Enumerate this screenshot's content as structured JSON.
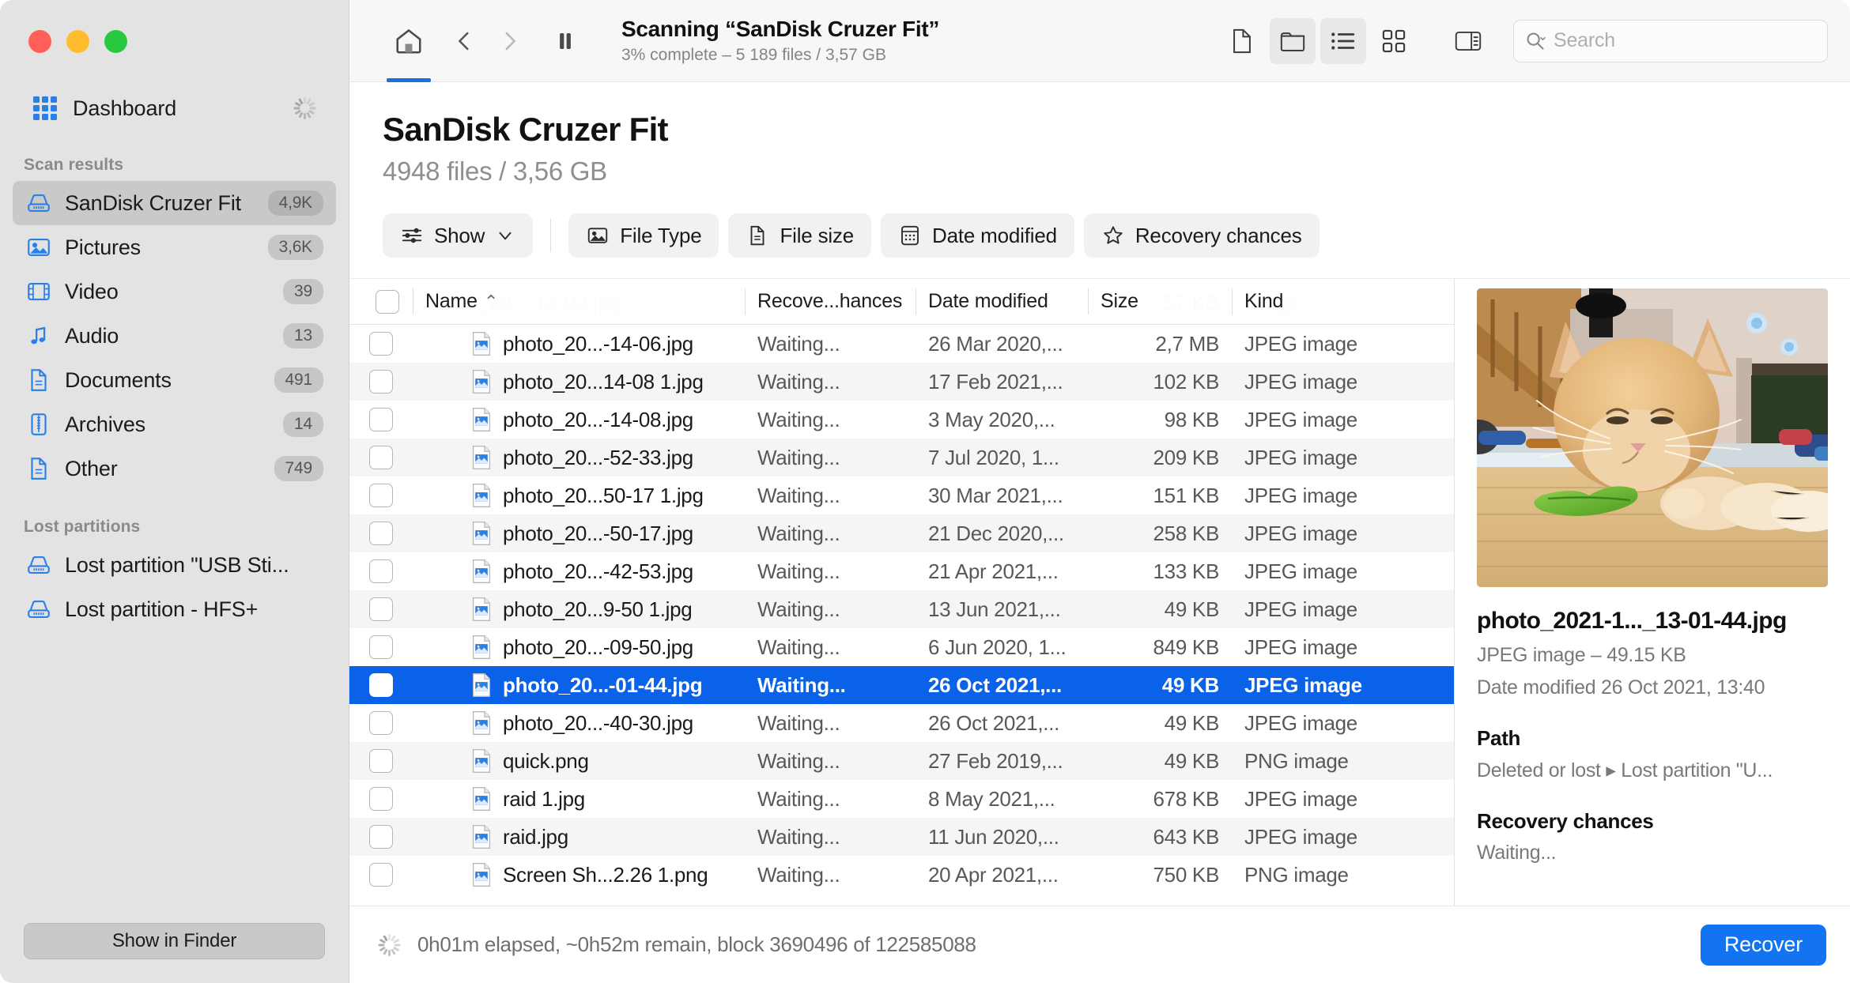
{
  "window": {
    "traffic_lights": [
      "close",
      "minimize",
      "maximize"
    ]
  },
  "sidebar": {
    "dashboard_label": "Dashboard",
    "scan_results_header": "Scan results",
    "scan_results": [
      {
        "label": "SanDisk Cruzer Fit",
        "badge": "4,9K",
        "icon": "drive-icon",
        "selected": true
      },
      {
        "label": "Pictures",
        "badge": "3,6K",
        "icon": "picture-icon",
        "selected": false
      },
      {
        "label": "Video",
        "badge": "39",
        "icon": "video-icon",
        "selected": false
      },
      {
        "label": "Audio",
        "badge": "13",
        "icon": "audio-icon",
        "selected": false
      },
      {
        "label": "Documents",
        "badge": "491",
        "icon": "document-icon",
        "selected": false
      },
      {
        "label": "Archives",
        "badge": "14",
        "icon": "archive-icon",
        "selected": false
      },
      {
        "label": "Other",
        "badge": "749",
        "icon": "document-icon",
        "selected": false
      }
    ],
    "lost_partitions_header": "Lost partitions",
    "lost_partitions": [
      {
        "label": "Lost partition \"USB Sti...",
        "icon": "drive-icon"
      },
      {
        "label": "Lost partition - HFS+",
        "icon": "drive-icon"
      }
    ],
    "show_in_finder_label": "Show in Finder"
  },
  "toolbar": {
    "home_icon": "home-icon",
    "back_icon": "chevron-left-icon",
    "forward_icon": "chevron-right-icon",
    "pause_icon": "pause-icon",
    "title": "Scanning “SanDisk Cruzer Fit”",
    "subtitle": "3% complete – 5 189 files / 3,57 GB",
    "view_buttons": [
      {
        "icon": "file-view-icon",
        "active": false
      },
      {
        "icon": "folder-view-icon",
        "active": true
      },
      {
        "icon": "list-view-icon",
        "active": true
      },
      {
        "icon": "grid-view-icon",
        "active": false
      },
      {
        "icon": "sidebar-toggle-icon",
        "active": false
      }
    ],
    "search_placeholder": "Search",
    "search_value": "",
    "search_icon": "search-icon"
  },
  "page": {
    "title": "SanDisk Cruzer Fit",
    "subtitle": "4948 files / 3,56 GB"
  },
  "filters": [
    {
      "label": "Show",
      "icon": "sliders-icon",
      "caret": true
    },
    {
      "label": "File Type",
      "icon": "picture-icon",
      "caret": false
    },
    {
      "label": "File size",
      "icon": "document-icon",
      "caret": false
    },
    {
      "label": "Date modified",
      "icon": "calendar-icon",
      "caret": false
    },
    {
      "label": "Recovery chances",
      "icon": "star-icon",
      "caret": false
    }
  ],
  "table": {
    "ghost_row": {
      "name": "photo_20...-14-02.jpg",
      "size": "57 KB",
      "kind": "image"
    },
    "columns": [
      {
        "key": "check",
        "label": ""
      },
      {
        "key": "name",
        "label": "Name",
        "sorted": true,
        "sort_caret": "⌃"
      },
      {
        "key": "recovery",
        "label": "Recove...hances"
      },
      {
        "key": "date",
        "label": "Date modified"
      },
      {
        "key": "size",
        "label": "Size"
      },
      {
        "key": "kind",
        "label": "Kind"
      }
    ],
    "rows": [
      {
        "name": "photo_20...-14-06.jpg",
        "recovery": "Waiting...",
        "date": "26 Mar 2020,...",
        "size": "2,7 MB",
        "kind": "JPEG image",
        "selected": false
      },
      {
        "name": "photo_20...14-08 1.jpg",
        "recovery": "Waiting...",
        "date": "17 Feb 2021,...",
        "size": "102 KB",
        "kind": "JPEG image",
        "selected": false
      },
      {
        "name": "photo_20...-14-08.jpg",
        "recovery": "Waiting...",
        "date": "3 May 2020,...",
        "size": "98 KB",
        "kind": "JPEG image",
        "selected": false
      },
      {
        "name": "photo_20...-52-33.jpg",
        "recovery": "Waiting...",
        "date": "7 Jul 2020, 1...",
        "size": "209 KB",
        "kind": "JPEG image",
        "selected": false
      },
      {
        "name": "photo_20...50-17 1.jpg",
        "recovery": "Waiting...",
        "date": "30 Mar 2021,...",
        "size": "151 KB",
        "kind": "JPEG image",
        "selected": false
      },
      {
        "name": "photo_20...-50-17.jpg",
        "recovery": "Waiting...",
        "date": "21 Dec 2020,...",
        "size": "258 KB",
        "kind": "JPEG image",
        "selected": false
      },
      {
        "name": "photo_20...-42-53.jpg",
        "recovery": "Waiting...",
        "date": "21 Apr 2021,...",
        "size": "133 KB",
        "kind": "JPEG image",
        "selected": false
      },
      {
        "name": "photo_20...9-50 1.jpg",
        "recovery": "Waiting...",
        "date": "13 Jun 2021,...",
        "size": "49 KB",
        "kind": "JPEG image",
        "selected": false
      },
      {
        "name": "photo_20...-09-50.jpg",
        "recovery": "Waiting...",
        "date": "6 Jun 2020, 1...",
        "size": "849 KB",
        "kind": "JPEG image",
        "selected": false
      },
      {
        "name": "photo_20...-01-44.jpg",
        "recovery": "Waiting...",
        "date": "26 Oct 2021,...",
        "size": "49 KB",
        "kind": "JPEG image",
        "selected": true
      },
      {
        "name": "photo_20...-40-30.jpg",
        "recovery": "Waiting...",
        "date": "26 Oct 2021,...",
        "size": "49 KB",
        "kind": "JPEG image",
        "selected": false
      },
      {
        "name": "quick.png",
        "recovery": "Waiting...",
        "date": "27 Feb 2019,...",
        "size": "49 KB",
        "kind": "PNG image",
        "selected": false
      },
      {
        "name": "raid 1.jpg",
        "recovery": "Waiting...",
        "date": "8 May 2021,...",
        "size": "678 KB",
        "kind": "JPEG image",
        "selected": false
      },
      {
        "name": "raid.jpg",
        "recovery": "Waiting...",
        "date": "11 Jun 2020,...",
        "size": "643 KB",
        "kind": "JPEG image",
        "selected": false
      },
      {
        "name": "Screen Sh...2.26 1.png",
        "recovery": "Waiting...",
        "date": "20 Apr 2021,...",
        "size": "750 KB",
        "kind": "PNG image",
        "selected": false
      }
    ]
  },
  "detail": {
    "preview_alt": "ginger cat eating a lettuce leaf on a wooden table",
    "filename": "photo_2021-1..._13-01-44.jpg",
    "type_size": "JPEG image – 49.15 KB",
    "date_modified": "Date modified 26 Oct 2021, 13:40",
    "path_header": "Path",
    "path_value": "Deleted or lost ▸ Lost partition \"U...",
    "recovery_header": "Recovery chances",
    "recovery_value": "Waiting..."
  },
  "statusbar": {
    "spinner_icon": "spinner-icon",
    "text": "0h01m elapsed, ~0h52m remain, block 3690496 of 122585088",
    "recover_label": "Recover"
  },
  "colors": {
    "accent_blue": "#1274f0",
    "selection_blue": "#0a62e8",
    "sidebar_bg": "#e3e3e3",
    "icon_blue": "#2a7fe8"
  }
}
